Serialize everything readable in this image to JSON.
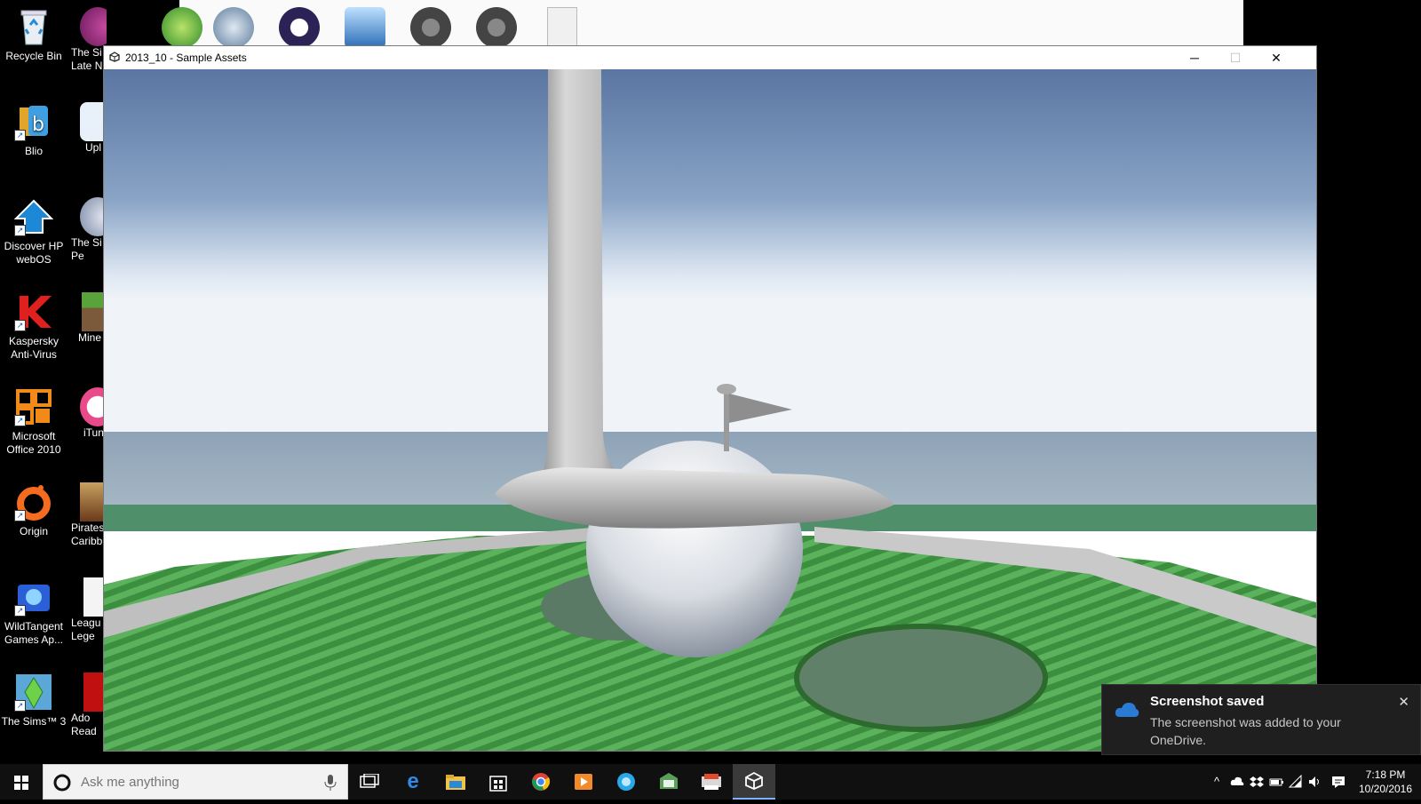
{
  "desktop": {
    "icons_col1": [
      {
        "label": "Recycle Bin",
        "icon": "recycle-bin-icon"
      },
      {
        "label": "Blio",
        "icon": "blio-icon"
      },
      {
        "label": "Discover HP webOS",
        "icon": "hp-webos-icon"
      },
      {
        "label": "Kaspersky Anti-Virus",
        "icon": "kaspersky-icon"
      },
      {
        "label": "Microsoft Office 2010",
        "icon": "office-icon"
      },
      {
        "label": "Origin",
        "icon": "origin-icon"
      },
      {
        "label": "WildTangent Games Ap...",
        "icon": "wildtangent-icon"
      },
      {
        "label": "The Sims™ 3",
        "icon": "sims3-icon"
      }
    ],
    "icons_col2": [
      {
        "label": "The Si Late N",
        "icon": "sims-late-night-icon"
      },
      {
        "label": "Upl",
        "icon": "uplay-icon"
      },
      {
        "label": "The Si Pe",
        "icon": "sims-pets-icon"
      },
      {
        "label": "Mine",
        "icon": "minecraft-icon"
      },
      {
        "label": "iTun",
        "icon": "itunes-icon"
      },
      {
        "label": "Pirates Caribb",
        "icon": "pirates-icon"
      },
      {
        "label": "Leagu Lege",
        "icon": "league-icon"
      },
      {
        "label": "Ado Read",
        "icon": "adobe-reader-icon"
      }
    ]
  },
  "window": {
    "title": "2013_10 - Sample Assets",
    "minimize": "─",
    "maximize": "☐",
    "close": "✕"
  },
  "toast": {
    "title": "Screenshot saved",
    "body": "The screenshot was added to your OneDrive.",
    "close": "✕",
    "icon": "onedrive-cloud-icon"
  },
  "taskbar": {
    "search_placeholder": "Ask me anything",
    "apps": [
      "task-view-icon",
      "edge-icon",
      "file-explorer-icon",
      "store-icon",
      "chrome-icon",
      "media-player-icon",
      "skype-icon",
      "dropbox-icon",
      "hp-icon",
      "unity-icon"
    ],
    "clock_time": "7:18 PM",
    "clock_date": "10/20/2016"
  },
  "colors": {
    "sky_top": "#5a77a3",
    "sky_horizon": "#e4ecf4",
    "grass": "#3f9c45",
    "taskbar": "#101010",
    "toast_bg": "#1f1f1f"
  }
}
